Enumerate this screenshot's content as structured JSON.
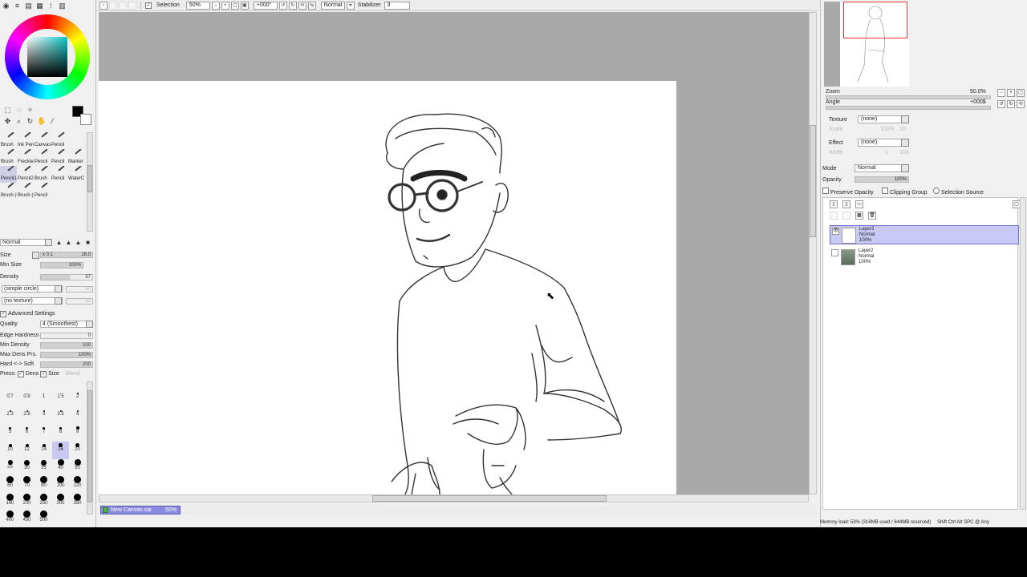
{
  "toolbar": {
    "selection_label": "Selection",
    "zoom_value": "50%",
    "rotation_value": "+000°",
    "blend_mode": "Normal",
    "stabilizer_label": "Stabilizer",
    "stabilizer_value": "3"
  },
  "brush_tools": [
    {
      "label": "Brush"
    },
    {
      "label": "Ink Pen"
    },
    {
      "label": "Canvas"
    },
    {
      "label": "Pencil"
    },
    {
      "label": ""
    },
    {
      "label": "Brush"
    },
    {
      "label": "Freckles"
    },
    {
      "label": "Pencil"
    },
    {
      "label": "Pencil"
    },
    {
      "label": "Marker"
    },
    {
      "label": "Pencil1"
    },
    {
      "label": "Pencil2"
    },
    {
      "label": "Brush"
    },
    {
      "label": "Pencil"
    },
    {
      "label": "WaterCo"
    },
    {
      "label": "Brush (L"
    },
    {
      "label": "Brush (C"
    },
    {
      "label": "Pencil"
    },
    {
      "label": ""
    },
    {
      "label": ""
    }
  ],
  "brush_settings": {
    "blend_mode": "Normal",
    "size_label": "Size",
    "size_multiplier": "x 0.1",
    "size_value": "16.0",
    "min_size_label": "Min Size",
    "min_size_value": "100%",
    "density_label": "Density",
    "density_value": "57",
    "shape": "(simple circle)",
    "shape_value": "50",
    "texture": "(no texture)",
    "texture_value": "95",
    "advanced_label": "Advanced Settings",
    "quality_label": "Quality",
    "quality_value": "4 (Smoothest)",
    "edge_hardness_label": "Edge Hardness",
    "edge_hardness_value": "0",
    "min_density_label": "Min Density",
    "min_density_value": "100",
    "max_dens_prs_label": "Max Dens Prs.",
    "max_dens_prs_value": "100%",
    "hard_soft_label": "Hard <-> Soft",
    "hard_soft_value": "200",
    "press_label": "Press:",
    "dens_label": "Dens",
    "size_check_label": "Size",
    "blend_label": "Blend"
  },
  "brush_sizes": [
    "0.7",
    "0.8",
    "1",
    "1.5",
    "2",
    "2.3",
    "2.6",
    "3",
    "3.5",
    "4",
    "5",
    "6",
    "7",
    "8",
    "9",
    "10",
    "12",
    "14",
    "16",
    "20",
    "25",
    "30",
    "35",
    "40",
    "50",
    "60",
    "70",
    "80",
    "100",
    "120",
    "160",
    "200",
    "250",
    "300",
    "350",
    "400",
    "450",
    "500"
  ],
  "document_tab": {
    "name": "New Canvas.sai",
    "zoom": "50%"
  },
  "navigator": {
    "zoom_label": "Zoom",
    "zoom_value": "50.0%",
    "angle_label": "Angle",
    "angle_value": "+000$"
  },
  "layer_props": {
    "texture_label": "Texture",
    "texture_value": "(none)",
    "texture_sub": "Scale",
    "texture_sub_value": "100%",
    "texture_sub_value2": "20",
    "effect_label": "Effect",
    "effect_value": "(none)",
    "effect_sub": "Width",
    "effect_sub_value": "1",
    "effect_sub_value2": "100",
    "mode_label": "Mode",
    "mode_value": "Normal",
    "opacity_label": "Opacity",
    "opacity_value": "100%",
    "preserve_opacity": "Preserve Opacity",
    "clipping_group": "Clipping Group",
    "selection_source": "Selection Source"
  },
  "layers": [
    {
      "name": "Layer3",
      "mode": "Normal",
      "opacity": "100%"
    },
    {
      "name": "Layer2",
      "mode": "Normal",
      "opacity": "100%"
    }
  ],
  "status": {
    "memory": "Memory load: 53% (318MB used / 644MB reserved)",
    "keys": "Shift Ctrl Alt SPC @ Any"
  },
  "colors": {
    "foreground": "#000000",
    "background": "#ffffff",
    "selected_layer": "#c9c9f5",
    "tab": "#8a8ae0"
  }
}
